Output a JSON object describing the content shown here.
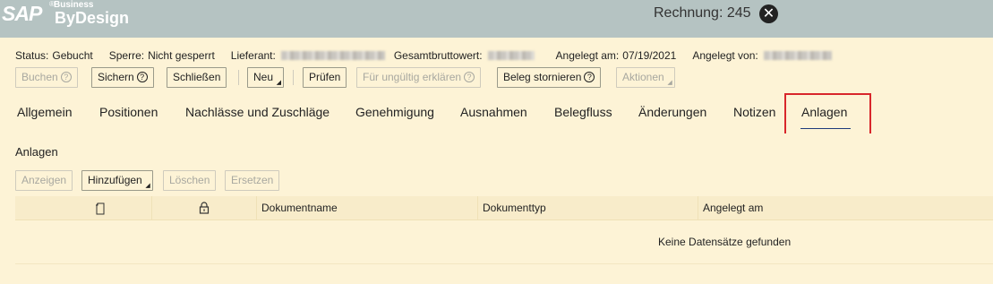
{
  "app": {
    "logo_sap": "SAP",
    "logo_reg": "®",
    "logo_business": "Business",
    "logo_bydesign": "ByDesign",
    "window_title": "Rechnung: 245",
    "close_glyph": "✕"
  },
  "status": {
    "status_label": "Status:",
    "status_value": "Gebucht",
    "sperre_label": "Sperre:",
    "sperre_value": "Nicht gesperrt",
    "lieferant_label": "Lieferant:",
    "gesamt_label": "Gesamtbruttowert:",
    "angelegt_am_label": "Angelegt am:",
    "angelegt_am_value": "07/19/2021",
    "angelegt_von_label": "Angelegt von:"
  },
  "toolbar": {
    "buchen": "Buchen",
    "sichern": "Sichern",
    "schliessen": "Schließen",
    "neu": "Neu",
    "pruefen": "Prüfen",
    "fuer_ungueltig": "Für ungültig erklären",
    "beleg_stornieren": "Beleg stornieren",
    "aktionen": "Aktionen",
    "help_glyph": "?"
  },
  "tabs": [
    {
      "label": "Allgemein"
    },
    {
      "label": "Positionen"
    },
    {
      "label": "Nachlässe und Zuschläge"
    },
    {
      "label": "Genehmigung"
    },
    {
      "label": "Ausnahmen"
    },
    {
      "label": "Belegfluss"
    },
    {
      "label": "Änderungen"
    },
    {
      "label": "Notizen"
    },
    {
      "label": "Anlagen"
    }
  ],
  "attachments": {
    "section_title": "Anlagen",
    "buttons": {
      "anzeigen": "Anzeigen",
      "hinzufuegen": "Hinzufügen",
      "loeschen": "Löschen",
      "ersetzen": "Ersetzen"
    },
    "columns": {
      "dokumentname": "Dokumentname",
      "dokumenttyp": "Dokumenttyp",
      "angelegt_am": "Angelegt am"
    },
    "empty_message": "Keine Datensätze gefunden"
  },
  "icons": {
    "document": "document-icon",
    "lock": "lock-icon",
    "help": "help-icon",
    "close": "close-icon"
  },
  "colors": {
    "header_bg": "#b5c3c2",
    "page_bg": "#fdf3d6",
    "highlight": "#d8262b",
    "active_tab_underline": "#1f3a7a"
  }
}
